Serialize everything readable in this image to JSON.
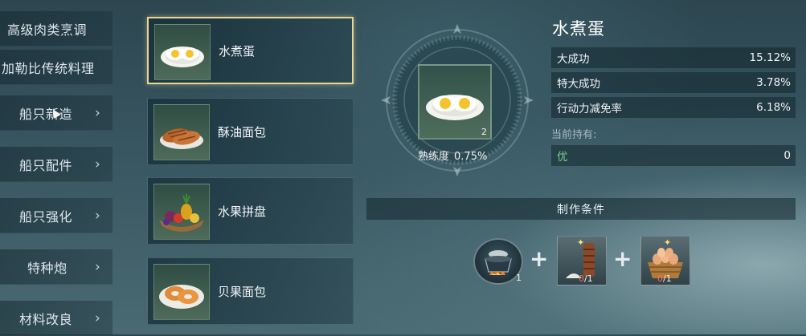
{
  "categories": [
    {
      "label": "高级肉类烹调",
      "has_arrow": false
    },
    {
      "label": "加勒比传统料理",
      "has_arrow": false
    },
    {
      "label": "船只新造",
      "has_arrow": true
    },
    {
      "label": "船只配件",
      "has_arrow": true
    },
    {
      "label": "船只强化",
      "has_arrow": true
    },
    {
      "label": "特种炮",
      "has_arrow": true
    },
    {
      "label": "材料改良",
      "has_arrow": true
    }
  ],
  "arrow_glyph": "›",
  "recipes": [
    {
      "name": "水煮蛋",
      "icon": "boiled-egg-icon",
      "selected": true
    },
    {
      "name": "酥油面包",
      "icon": "butter-bread-icon",
      "selected": false
    },
    {
      "name": "水果拼盘",
      "icon": "fruit-platter-icon",
      "selected": false
    },
    {
      "name": "贝果面包",
      "icon": "bagel-icon",
      "selected": false
    }
  ],
  "detail": {
    "title": "水煮蛋",
    "count": "2",
    "proficiency_label": "熟练度",
    "proficiency_value": "0.75%",
    "stats": [
      {
        "label": "大成功",
        "value": "15.12%"
      },
      {
        "label": "特大成功",
        "value": "3.78%"
      },
      {
        "label": "行动力减免率",
        "value": "6.18%"
      }
    ],
    "held_label": "当前持有:",
    "held": {
      "grade": "优",
      "value": "0"
    },
    "requirements_label": "制作条件",
    "materials": [
      {
        "icon": "cooking-pot-icon",
        "qty": "1"
      },
      {
        "icon": "salt-jar-icon",
        "have": "0",
        "need": "/1"
      },
      {
        "icon": "egg-basket-icon",
        "have": "0",
        "need": "/1"
      }
    ],
    "plus": "+"
  },
  "colors": {
    "selected_border": "#e8d592",
    "grade_good": "#7bd18a",
    "missing": "#ff6a5a"
  }
}
